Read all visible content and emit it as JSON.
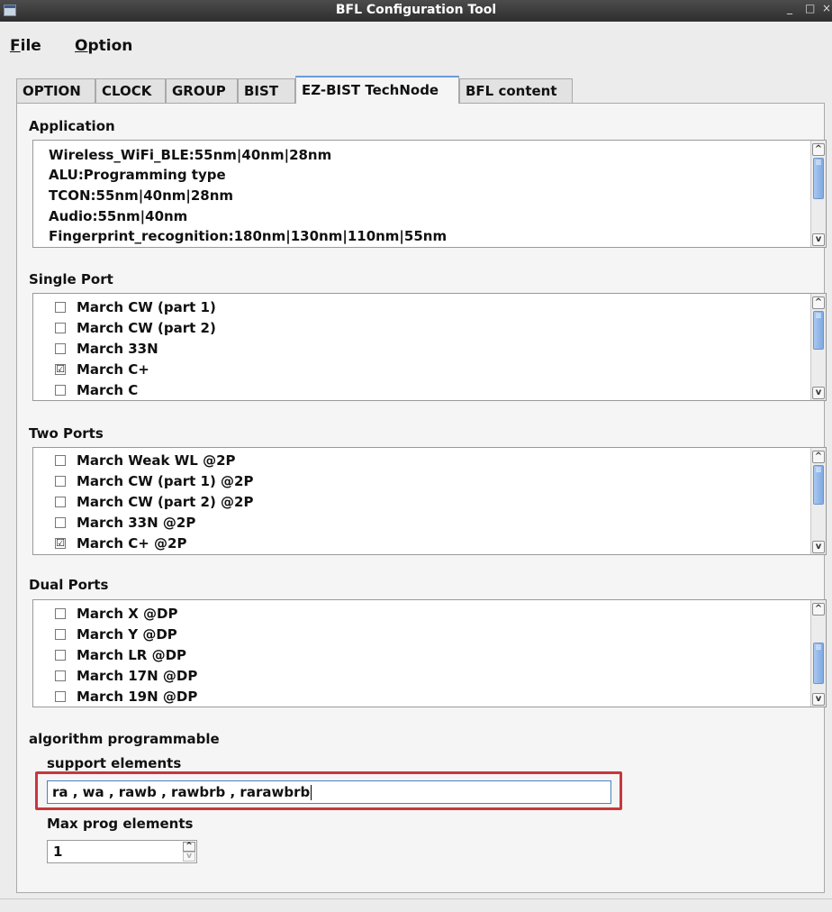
{
  "window": {
    "title": "BFL Configuration Tool",
    "controls": [
      "_",
      "□",
      "×"
    ]
  },
  "menu": {
    "file": {
      "mnemonic": "F",
      "rest": "ile"
    },
    "option": {
      "mnemonic": "O",
      "rest": "ption"
    }
  },
  "tabs": [
    {
      "label": "OPTION"
    },
    {
      "label": "CLOCK"
    },
    {
      "label": "GROUP"
    },
    {
      "label": "BIST"
    },
    {
      "label": "EZ-BIST TechNode",
      "active": true
    },
    {
      "label": "BFL content"
    }
  ],
  "application": {
    "label": "Application",
    "items": [
      "Wireless_WiFi_BLE:55nm|40nm|28nm",
      "ALU:Programming type",
      "TCON:55nm|40nm|28nm",
      "Audio:55nm|40nm",
      "Fingerprint_recognition:180nm|130nm|110nm|55nm"
    ]
  },
  "single_port": {
    "label": "Single Port",
    "items": [
      {
        "label": "March CW (part 1)",
        "checked": false
      },
      {
        "label": "March CW (part 2)",
        "checked": false
      },
      {
        "label": "March 33N",
        "checked": false
      },
      {
        "label": "March C+",
        "checked": true
      },
      {
        "label": "March C",
        "checked": false
      }
    ]
  },
  "two_ports": {
    "label": "Two Ports",
    "items": [
      {
        "label": "March Weak WL @2P",
        "checked": false
      },
      {
        "label": "March CW (part 1) @2P",
        "checked": false
      },
      {
        "label": "March CW (part 2) @2P",
        "checked": false
      },
      {
        "label": "March 33N @2P",
        "checked": false
      },
      {
        "label": "March C+ @2P",
        "checked": true
      }
    ]
  },
  "dual_ports": {
    "label": "Dual Ports",
    "items": [
      {
        "label": "March X @DP",
        "checked": false
      },
      {
        "label": "March Y @DP",
        "checked": false
      },
      {
        "label": "March LR @DP",
        "checked": false
      },
      {
        "label": "March 17N @DP",
        "checked": false
      },
      {
        "label": "March 19N @DP",
        "checked": false
      }
    ]
  },
  "algorithm": {
    "label": "algorithm programmable",
    "support_label": "support elements",
    "support_value": "ra , wa , rawb , rawbrb , rarawbrb",
    "max_label": "Max prog elements",
    "max_value": "1"
  },
  "colors": {
    "highlight_border": "#c8373d",
    "active_tab_accent": "#6b9bd8",
    "scroll_thumb": "#7fa9e1"
  },
  "icons": {
    "check": "☑",
    "scroll_up": "chevron-up-icon",
    "scroll_down": "chevron-down-icon"
  }
}
